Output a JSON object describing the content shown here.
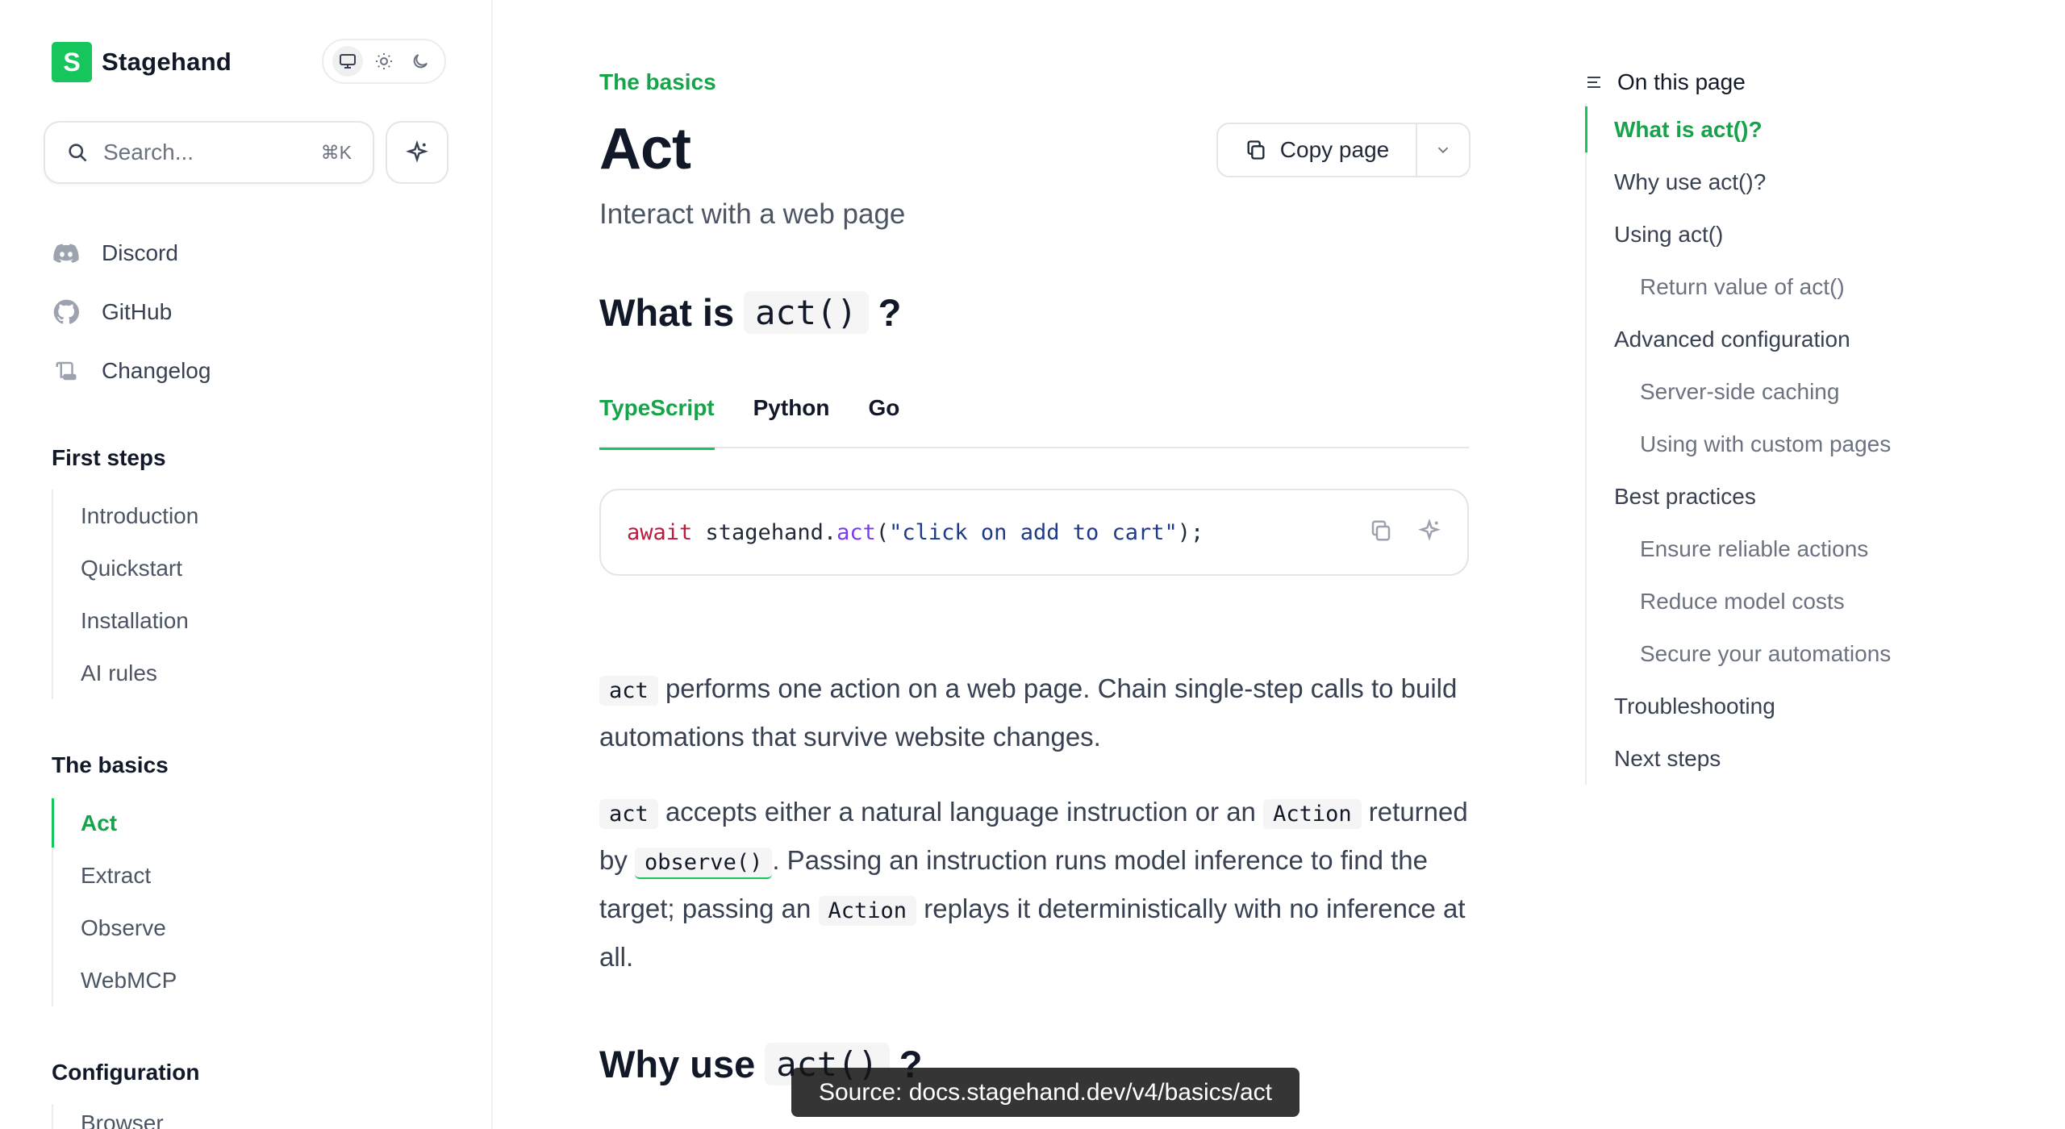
{
  "brand": {
    "mark": "S",
    "name": "Stagehand"
  },
  "search": {
    "placeholder": "Search...",
    "shortcut": "⌘K"
  },
  "links": [
    {
      "label": "Discord"
    },
    {
      "label": "GitHub"
    },
    {
      "label": "Changelog"
    }
  ],
  "nav": {
    "first_steps": {
      "heading": "First steps",
      "items": [
        "Introduction",
        "Quickstart",
        "Installation",
        "AI rules"
      ]
    },
    "basics": {
      "heading": "The basics",
      "items": [
        "Act",
        "Extract",
        "Observe",
        "WebMCP"
      ],
      "active": "Act"
    },
    "configuration": {
      "heading": "Configuration",
      "items": [
        "Browser"
      ]
    }
  },
  "page": {
    "eyebrow": "The basics",
    "title": "Act",
    "subtitle": "Interact with a web page",
    "copy_label": "Copy page",
    "h2_what": {
      "prefix": "What is",
      "code": "act()",
      "suffix": "?"
    },
    "h2_why": {
      "prefix": "Why use",
      "code": "act()",
      "suffix": "?"
    },
    "tabs": [
      "TypeScript",
      "Python",
      "Go"
    ],
    "active_tab": "TypeScript",
    "code": {
      "kw": "await",
      "obj": " stagehand.",
      "fn": "act",
      "open": "(",
      "str": "\"click on add to cart\"",
      "close": ");"
    },
    "para1": {
      "code": "act",
      "text": " performs one action on a web page. Chain single-step calls to build automations that survive website changes."
    },
    "para2": {
      "code1": "act",
      "t1": " accepts either a natural language instruction or an ",
      "code2": "Action",
      "t2": " returned by ",
      "code3": "observe()",
      "t3": ". Passing an instruction runs model inference to find the target; passing an ",
      "code4": "Action",
      "t4": " replays it deterministically with no inference at all."
    }
  },
  "toc": {
    "title": "On this page",
    "items": [
      {
        "label": "What is act()?",
        "level": 1,
        "active": true
      },
      {
        "label": "Why use act()?",
        "level": 1
      },
      {
        "label": "Using act()",
        "level": 1
      },
      {
        "label": "Return value of act()",
        "level": 2
      },
      {
        "label": "Advanced configuration",
        "level": 1
      },
      {
        "label": "Server-side caching",
        "level": 2
      },
      {
        "label": "Using with custom pages",
        "level": 2
      },
      {
        "label": "Best practices",
        "level": 1
      },
      {
        "label": "Ensure reliable actions",
        "level": 2
      },
      {
        "label": "Reduce model costs",
        "level": 2
      },
      {
        "label": "Secure your automations",
        "level": 2
      },
      {
        "label": "Troubleshooting",
        "level": 1
      },
      {
        "label": "Next steps",
        "level": 1
      }
    ]
  },
  "source_overlay": "Source: docs.stagehand.dev/v4/basics/act",
  "colors": {
    "accent": "#16c55c",
    "accent_text": "#16a34a"
  }
}
